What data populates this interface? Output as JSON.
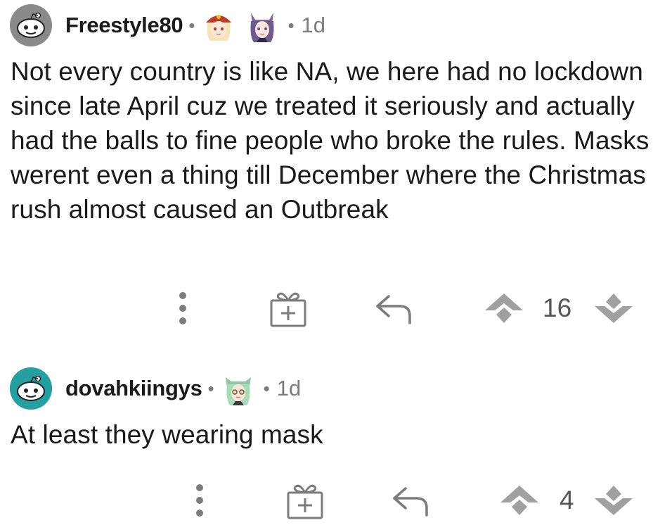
{
  "comments": [
    {
      "username": "Freestyle80",
      "separator": "•",
      "age": "1d",
      "flair_icons": [
        "anime-girl-red-hat-icon",
        "anime-girl-purple-hair-icon"
      ],
      "body": "Not every country is like NA, we here had no lockdown since late April cuz we treated it seriously and actually had the balls to fine people who broke the rules. Masks werent even a thing till December where the Christmas rush almost caused an Outbreak",
      "votes": "16",
      "avatar_color": "#8a8a8a"
    },
    {
      "username": "dovahkiingys",
      "separator": "•",
      "age": "1d",
      "flair_icons": [
        "anime-girl-green-hair-icon"
      ],
      "body": "At least they wearing mask",
      "votes": "4",
      "avatar_color": "#24a0a0"
    }
  ],
  "colors": {
    "text": "#1a1a1b",
    "meta": "#7c7c7c",
    "icon": "#7c7c7c",
    "vote_icon": "#a0a0a0"
  }
}
